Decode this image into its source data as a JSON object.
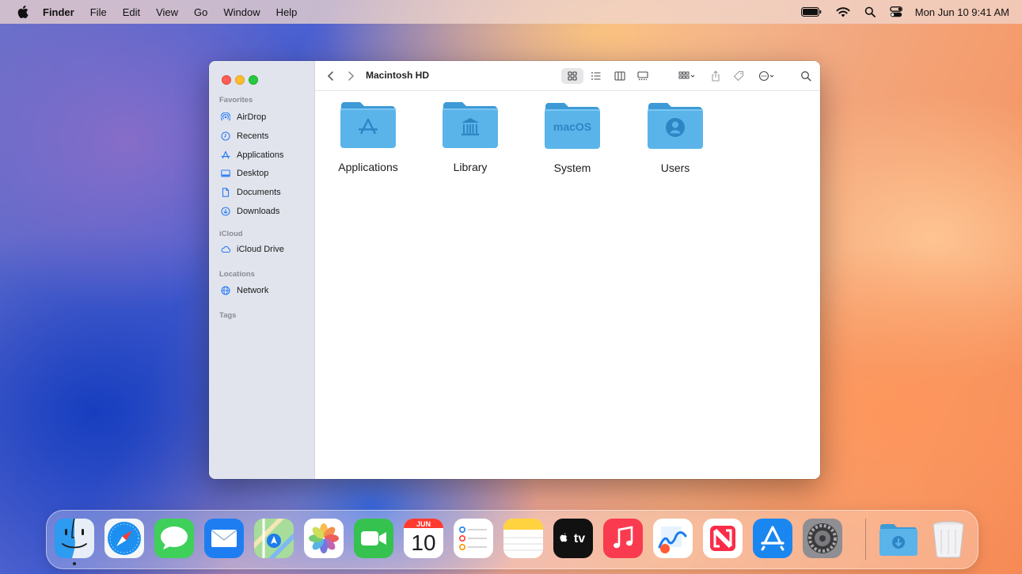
{
  "menubar": {
    "app_name": "Finder",
    "menus": [
      "File",
      "Edit",
      "View",
      "Go",
      "Window",
      "Help"
    ],
    "clock": "Mon Jun 10  9:41 AM",
    "status_icons": [
      "battery-icon",
      "wifi-icon",
      "spotlight-icon",
      "control-center-icon"
    ]
  },
  "window": {
    "title": "Macintosh HD",
    "sidebar": {
      "favorites_header": "Favorites",
      "favorites": [
        {
          "label": "AirDrop",
          "icon": "airdrop-icon"
        },
        {
          "label": "Recents",
          "icon": "clock-icon"
        },
        {
          "label": "Applications",
          "icon": "applications-icon"
        },
        {
          "label": "Desktop",
          "icon": "desktop-icon"
        },
        {
          "label": "Documents",
          "icon": "document-icon"
        },
        {
          "label": "Downloads",
          "icon": "download-icon"
        }
      ],
      "icloud_header": "iCloud",
      "icloud": [
        {
          "label": "iCloud Drive",
          "icon": "cloud-icon"
        }
      ],
      "locations_header": "Locations",
      "locations": [
        {
          "label": "Network",
          "icon": "globe-icon"
        }
      ],
      "tags_header": "Tags"
    },
    "items": [
      {
        "label": "Applications",
        "glyph": "app-store-glyph"
      },
      {
        "label": "Library",
        "glyph": "library-glyph"
      },
      {
        "label": "System",
        "glyph_text": "macOS"
      },
      {
        "label": "Users",
        "glyph": "user-glyph"
      }
    ]
  },
  "dock": {
    "apps": [
      "Finder",
      "Safari",
      "Messages",
      "Mail",
      "Maps",
      "Photos",
      "FaceTime",
      "Calendar",
      "Reminders",
      "Notes",
      "TV",
      "Music",
      "Freeform",
      "News",
      "App Store",
      "System Settings"
    ],
    "calendar_month": "JUN",
    "calendar_day": "10",
    "tv_label": "tv",
    "extras": [
      "Downloads",
      "Trash"
    ]
  },
  "colors": {
    "folder_blue": "#5ab4ea",
    "folder_tab": "#4aa3dd"
  }
}
